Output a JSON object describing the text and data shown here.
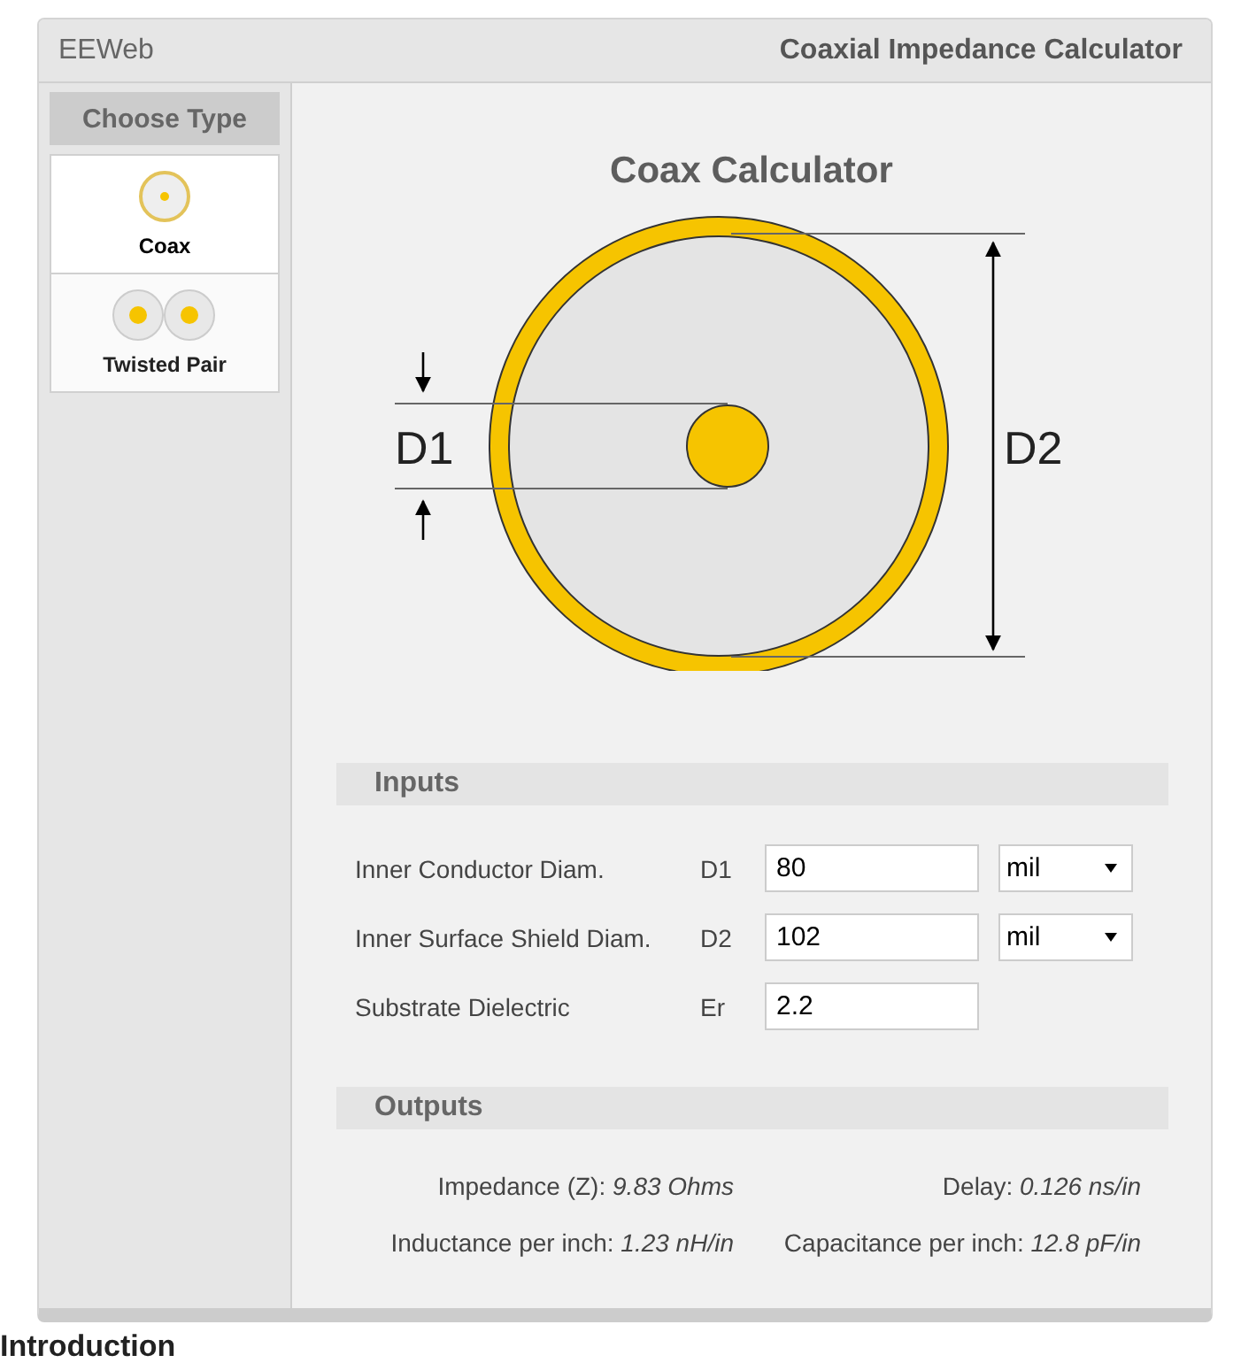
{
  "header": {
    "brand": "EEWeb",
    "title": "Coaxial Impedance Calculator"
  },
  "sidebar": {
    "heading": "Choose Type",
    "items": [
      {
        "label": "Coax",
        "kind": "coax",
        "selected": true
      },
      {
        "label": "Twisted Pair",
        "kind": "pair",
        "selected": false
      }
    ]
  },
  "main": {
    "title": "Coax Calculator",
    "diagram": {
      "inner_label": "D1",
      "outer_label": "D2"
    }
  },
  "inputs": {
    "heading": "Inputs",
    "rows": [
      {
        "label": "Inner Conductor Diam.",
        "symbol": "D1",
        "value": "80",
        "unit": "mil"
      },
      {
        "label": "Inner Surface Shield Diam.",
        "symbol": "D2",
        "value": "102",
        "unit": "mil"
      },
      {
        "label": "Substrate Dielectric",
        "symbol": "Er",
        "value": "2.2"
      }
    ]
  },
  "outputs": {
    "heading": "Outputs",
    "items": [
      {
        "label": "Impedance (Z):",
        "value": "9.83 Ohms"
      },
      {
        "label": "Delay:",
        "value": "0.126 ns/in"
      },
      {
        "label": "Inductance per inch:",
        "value": "1.23 nH/in"
      },
      {
        "label": "Capacitance per inch:",
        "value": "12.8 pF/in"
      }
    ]
  },
  "below": {
    "heading": "Introduction"
  }
}
